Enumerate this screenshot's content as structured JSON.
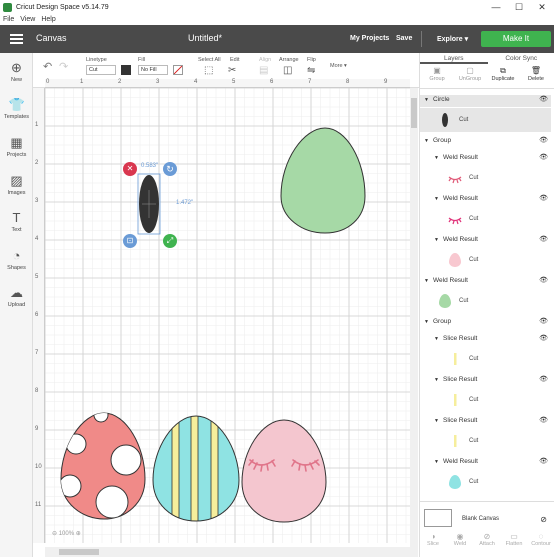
{
  "window": {
    "title": "Cricut Design Space  v5.14.79",
    "minimize": "—",
    "maximize": "☐",
    "close": "✕"
  },
  "menu": [
    "File",
    "View",
    "Help"
  ],
  "header": {
    "canvas": "Canvas",
    "title": "Untitled*",
    "my_projects": "My Projects",
    "save": "Save",
    "explore": "Explore ▾",
    "make_it": "Make It"
  },
  "leftbar": [
    {
      "label": "New",
      "icon": "plus-icon",
      "glyph": "⊕"
    },
    {
      "label": "Templates",
      "icon": "shirt-icon",
      "glyph": "👕"
    },
    {
      "label": "Projects",
      "icon": "projects-icon",
      "glyph": "▦"
    },
    {
      "label": "Images",
      "icon": "image-icon",
      "glyph": "▨"
    },
    {
      "label": "Text",
      "icon": "text-icon",
      "glyph": "T"
    },
    {
      "label": "Shapes",
      "icon": "shapes-icon",
      "glyph": "◔"
    },
    {
      "label": "Upload",
      "icon": "upload-icon",
      "glyph": "☁"
    }
  ],
  "toolbar": {
    "undo": "↶",
    "redo": "↷",
    "linetype_label": "Linetype",
    "linetype_value": "Cut",
    "fill_label": "Fill",
    "fill_value": "No Fill",
    "select_all": "Select All",
    "edit": "Edit",
    "align": "Align",
    "arrange": "Arrange",
    "flip": "Flip",
    "more": "More ▾",
    "linetype_color": "#333333"
  },
  "ruler": {
    "h": [
      "0",
      "1",
      "2",
      "3",
      "4",
      "5",
      "6",
      "7",
      "8",
      "9"
    ],
    "v": [
      "1",
      "2",
      "3",
      "4",
      "5",
      "6",
      "7",
      "8",
      "9",
      "10",
      "11"
    ]
  },
  "selection": {
    "width": "0.583\"",
    "height": "1.472\""
  },
  "zoom": "100%",
  "panel": {
    "tabs": [
      "Layers",
      "Color Sync"
    ],
    "actions": [
      {
        "label": "Group",
        "i": "▣",
        "enabled": false
      },
      {
        "label": "UnGroup",
        "i": "▢",
        "enabled": false
      },
      {
        "label": "Duplicate",
        "i": "⧉",
        "enabled": true
      },
      {
        "label": "Delete",
        "i": "🗑",
        "enabled": true
      }
    ],
    "layers": [
      {
        "name": "Circle",
        "level": 0,
        "selected": true
      },
      {
        "cut": "Cut",
        "thumb": "oval",
        "color": "#333333",
        "level": 0,
        "selected": true
      },
      {
        "name": "Group",
        "level": 0
      },
      {
        "name": "Weld Result",
        "level": 1
      },
      {
        "cut": "Cut",
        "thumb": "lash",
        "color": "#e05a78",
        "level": 1
      },
      {
        "name": "Weld Result",
        "level": 1
      },
      {
        "cut": "Cut",
        "thumb": "lash",
        "color": "#e0347a",
        "level": 1
      },
      {
        "name": "Weld Result",
        "level": 1
      },
      {
        "cut": "Cut",
        "thumb": "egg",
        "color": "#f8c8d0",
        "level": 1
      },
      {
        "name": "Weld Result",
        "level": 0
      },
      {
        "cut": "Cut",
        "thumb": "egg",
        "color": "#a6d9a6",
        "level": 0
      },
      {
        "name": "Group",
        "level": 0
      },
      {
        "name": "Slice Result",
        "level": 1
      },
      {
        "cut": "Cut",
        "thumb": "bar",
        "color": "#f6ee9c",
        "level": 1
      },
      {
        "name": "Slice Result",
        "level": 1
      },
      {
        "cut": "Cut",
        "thumb": "bar",
        "color": "#f6ee9c",
        "level": 1
      },
      {
        "name": "Slice Result",
        "level": 1
      },
      {
        "cut": "Cut",
        "thumb": "bar",
        "color": "#f6ee9c",
        "level": 1
      },
      {
        "name": "Weld Result",
        "level": 1
      },
      {
        "cut": "Cut",
        "thumb": "egg",
        "color": "#8fe3e3",
        "level": 1
      }
    ],
    "blank_canvas": "Blank Canvas",
    "bottom": [
      {
        "label": "Slice",
        "i": "◑"
      },
      {
        "label": "Weld",
        "i": "◉"
      },
      {
        "label": "Attach",
        "i": "⊘"
      },
      {
        "label": "Flatten",
        "i": "▭"
      },
      {
        "label": "Contour",
        "i": "◌"
      }
    ]
  },
  "colors": {
    "green_egg": "#a6d9a6",
    "pink_egg": "#f4c6cf",
    "red_egg": "#f08a88",
    "stripe_cyan": "#8fe3e3",
    "stripe_yellow": "#f6ee9c",
    "lash": "#e0758a",
    "make_it": "#3fb34f"
  }
}
